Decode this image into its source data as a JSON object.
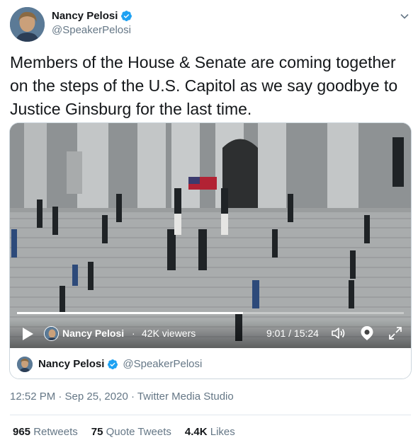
{
  "author": {
    "display_name": "Nancy Pelosi",
    "handle": "@SpeakerPelosi"
  },
  "tweet": {
    "text": "Members of the House & Senate are coming together on the steps of the U.S. Capitol as we say goodbye to Justice Ginsburg for the last time."
  },
  "video": {
    "channel_name": "Nancy Pelosi",
    "separator": "·",
    "viewers": "42K viewers",
    "time": "9:01 / 15:24",
    "progress_fraction": 0.585
  },
  "source": {
    "display_name": "Nancy Pelosi",
    "handle": "@SpeakerPelosi"
  },
  "meta": {
    "timestamp": "12:52 PM · Sep 25, 2020 · Twitter Media Studio"
  },
  "stats": {
    "retweets_count": "965",
    "retweets_label": "Retweets",
    "quotes_count": "75",
    "quotes_label": "Quote Tweets",
    "likes_count": "4.4K",
    "likes_label": "Likes"
  },
  "colors": {
    "verified_blue": "#1da1f2",
    "secondary_text": "#657786",
    "primary_text": "#14171a",
    "border": "#ccd6dd"
  },
  "icons": {
    "verified": "verified-badge-icon",
    "caret": "chevron-down-icon",
    "play": "play-icon",
    "volume": "volume-icon",
    "periscope": "periscope-icon",
    "expand": "expand-icon"
  }
}
